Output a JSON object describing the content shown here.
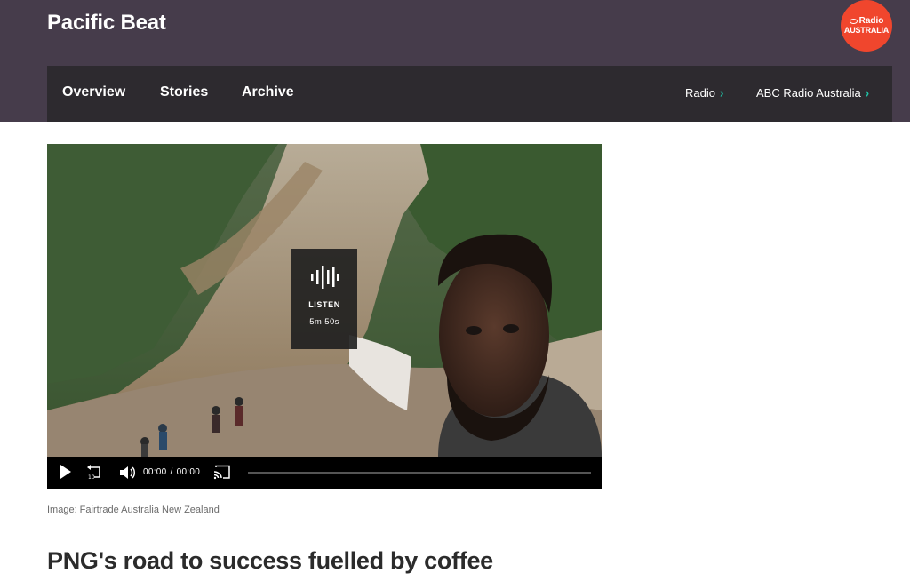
{
  "header": {
    "program_title": "Pacific Beat",
    "logo_line1": "Radio",
    "logo_line2": "AUSTRALIA",
    "logo_icon": "abc-logo-icon"
  },
  "nav": {
    "items": [
      {
        "label": "Overview"
      },
      {
        "label": "Stories"
      },
      {
        "label": "Archive"
      }
    ],
    "right_links": [
      {
        "label": "Radio",
        "icon": "chevron-right-icon"
      },
      {
        "label": "ABC Radio Australia",
        "icon": "chevron-right-icon"
      }
    ]
  },
  "media": {
    "listen_label": "LISTEN",
    "duration": "5m 50s",
    "current_time": "00:00",
    "separator": "/",
    "total_time": "00:00",
    "progress": 0
  },
  "caption": "Image: Fairtrade Australia New Zealand",
  "headline": "PNG's road to success fuelled by coffee",
  "colors": {
    "header_bg": "#463c4b",
    "nav_bg": "#2d2a2f",
    "accent_teal": "#20c2a6",
    "logo_red": "#f0462d"
  }
}
